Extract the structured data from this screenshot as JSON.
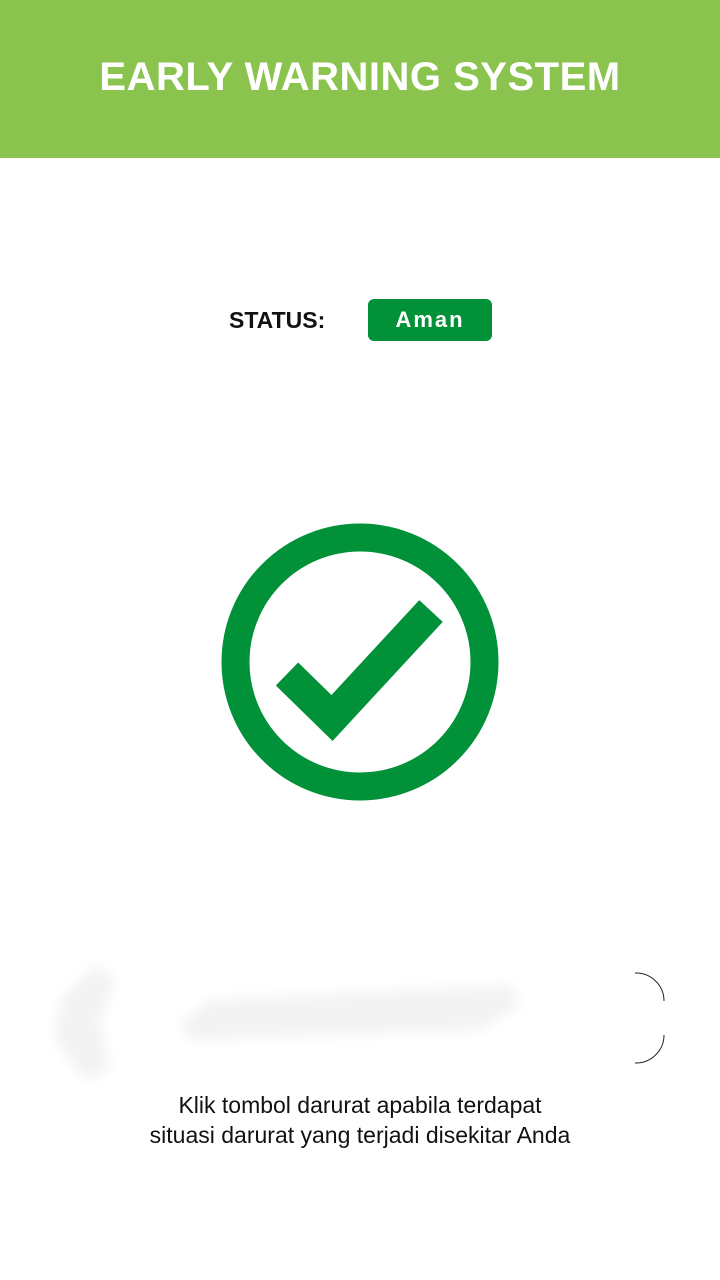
{
  "header": {
    "title": "EARLY WARNING SYSTEM",
    "background_color": "#8bc34f"
  },
  "status": {
    "label": "STATUS:",
    "value": "Aman",
    "badge_color": "#019139",
    "icon": "check-circle-icon",
    "icon_color": "#019139"
  },
  "emergency": {
    "button_icon": "emergency-button-graphic"
  },
  "helper": {
    "line1": "Klik tombol darurat apabila terdapat",
    "line2": "situasi darurat yang terjadi disekitar Anda"
  }
}
